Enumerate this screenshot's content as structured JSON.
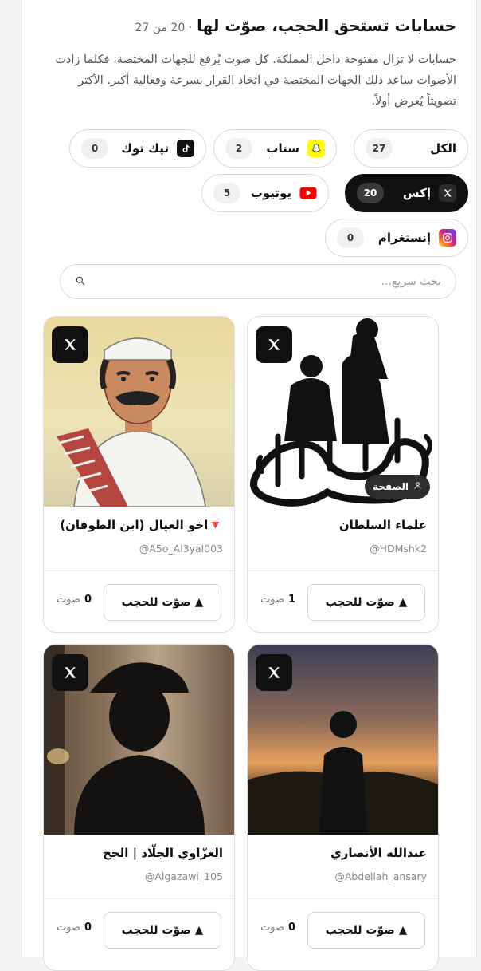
{
  "header": {
    "title": "حسابات تستحق الحجب، صوّت لها",
    "count": "· 20 من 27",
    "description": "حسابات لا تزال مفتوحة داخل المملكة. كل صوت يُرفع للجهات المختصة، فكلما زادت الأصوات ساعد ذلك الجهات المختصة في اتخاذ القرار بسرعة وفعالية أكبر. الأكثر تصويتاً يُعرض أولاً."
  },
  "filters": [
    {
      "label": "الكل",
      "count": "27",
      "icon": "none",
      "active": false
    },
    {
      "label": "سناب",
      "count": "2",
      "icon": "snapchat-icon",
      "active": false
    },
    {
      "label": "تيك توك",
      "count": "0",
      "icon": "tiktok-icon",
      "active": false
    },
    {
      "label": "إكس",
      "count": "20",
      "icon": "x-icon",
      "active": true
    },
    {
      "label": "يوتيوب",
      "count": "5",
      "icon": "youtube-icon",
      "active": false
    },
    {
      "label": "إنستغرام",
      "count": "0",
      "icon": "instagram-icon",
      "active": false
    }
  ],
  "search": {
    "placeholder": "بحث سريع..."
  },
  "cards": [
    {
      "name": "علماء السلطان",
      "handle": "@HDMshk2",
      "votes": "1",
      "badge": "الصفحة"
    },
    {
      "name": "🔻اخو العيال (ابن الطوفان)",
      "handle": "@A5o_Al3yal003",
      "votes": "0"
    },
    {
      "name": "عبدالله الأنصاري",
      "handle": "@Abdellah_ansary",
      "votes": "0"
    },
    {
      "name": "الغزّاوي الجلّاد | الحج",
      "handle": "@Algazawi_105",
      "votes": "0"
    }
  ],
  "labels": {
    "vote_button": "▲ صوّت للحجب",
    "vote_unit": "صوت"
  },
  "colors": {
    "active_chip": "#111111",
    "accent_bg": "#ffffff",
    "snap": "#FFFC00",
    "youtube": "#FF0000"
  }
}
